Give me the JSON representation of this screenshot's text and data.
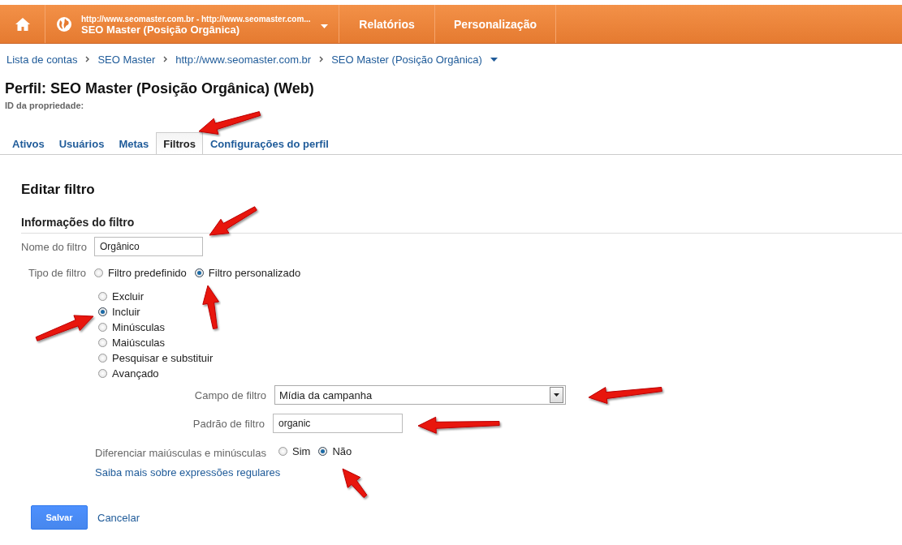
{
  "nav": {
    "account_url": "http://www.seomaster.com.br - http://www.seomaster.com...",
    "profile": "SEO Master (Posição Orgânica)",
    "items": [
      "Relatórios",
      "Personalização"
    ]
  },
  "breadcrumbs": [
    "Lista de contas",
    "SEO Master",
    "http://www.seomaster.com.br",
    "SEO Master (Posição Orgânica)"
  ],
  "profile_title": "Perfil: SEO Master (Posição Orgânica) (Web)",
  "property_id_label": "ID da propriedade:",
  "tabs": [
    {
      "label": "Ativos",
      "selected": false
    },
    {
      "label": "Usuários",
      "selected": false
    },
    {
      "label": "Metas",
      "selected": false
    },
    {
      "label": "Filtros",
      "selected": true
    },
    {
      "label": "Configurações do perfil",
      "selected": false
    }
  ],
  "form": {
    "heading": "Editar filtro",
    "section": "Informações do filtro",
    "name_label": "Nome do filtro",
    "name_value": "Orgânico",
    "type_label": "Tipo de filtro",
    "type_options": [
      {
        "label": "Filtro predefinido",
        "selected": false
      },
      {
        "label": "Filtro personalizado",
        "selected": true
      }
    ],
    "custom_options": [
      {
        "label": "Excluir",
        "selected": false
      },
      {
        "label": "Incluir",
        "selected": true
      },
      {
        "label": "Minúsculas",
        "selected": false
      },
      {
        "label": "Maiúsculas",
        "selected": false
      },
      {
        "label": "Pesquisar e substituir",
        "selected": false
      },
      {
        "label": "Avançado",
        "selected": false
      }
    ],
    "field_label": "Campo de filtro",
    "field_value": "Mídia da campanha",
    "pattern_label": "Padrão de filtro",
    "pattern_value": "organic",
    "case_label": "Diferenciar maiúsculas e minúsculas",
    "case_options": [
      {
        "label": "Sim",
        "selected": false
      },
      {
        "label": "Não",
        "selected": true
      }
    ],
    "help_link": "Saiba mais sobre expressões regulares",
    "save": "Salvar",
    "cancel": "Cancelar"
  }
}
